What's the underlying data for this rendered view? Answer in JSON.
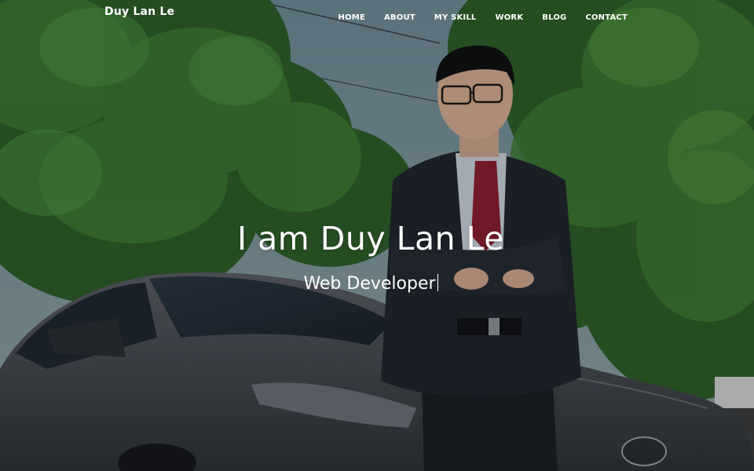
{
  "site": {
    "brand": "Duy Lan Le"
  },
  "nav": {
    "items": [
      {
        "label": "HOME"
      },
      {
        "label": "ABOUT"
      },
      {
        "label": "MY SKILL"
      },
      {
        "label": "WORK"
      },
      {
        "label": "BLOG"
      },
      {
        "label": "CONTACT"
      }
    ]
  },
  "hero": {
    "title": "I am Duy Lan Le",
    "subtitle": "Web Developer"
  }
}
